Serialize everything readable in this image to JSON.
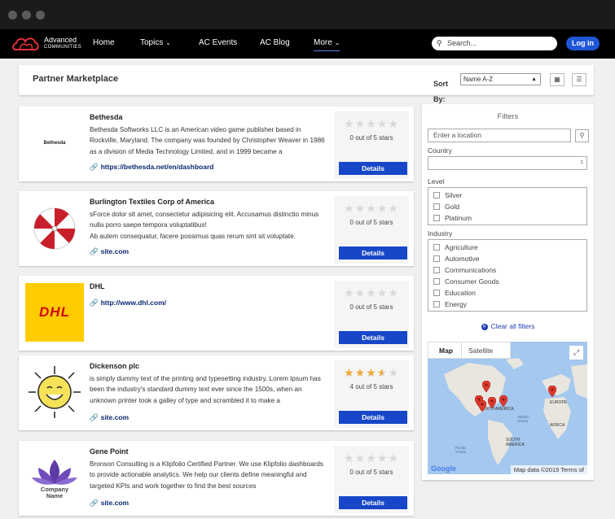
{
  "nav": {
    "brand_line1": "Advanced",
    "brand_line2": "COMMUNITIES",
    "items": [
      {
        "label": "Home"
      },
      {
        "label": "Topics",
        "has_caret": true
      },
      {
        "label": "AC Events"
      },
      {
        "label": "AC Blog"
      },
      {
        "label": "More",
        "has_caret": true
      }
    ],
    "search_placeholder": "Search...",
    "login_label": "Log in",
    "accent_color": "#1f56d8"
  },
  "header": {
    "title": "Partner Marketplace",
    "sort_label": "Sort By:",
    "sort_value": "Name A-Z",
    "grid_icon": "grid-view-icon",
    "list_icon": "list-view-icon"
  },
  "partners": [
    {
      "name": "Bethesda",
      "logo_text": "Bethesda",
      "description": "Bethesda Softworks LLC is an American video game publisher based in Rockville, Maryland. The company was founded by Christopher Weaver in 1986 as a division of Media Technology Limited, and in 1999 became a",
      "link": "https://bethesda.net/en/dashboard",
      "stars": 0,
      "rating_text": "0 out of 5 stars",
      "button": "Details"
    },
    {
      "name": "Burlington Textiles Corp of America",
      "description": "sForce dolor sit amet, consectetur adipisicing elit. Accusamus distinctio minus nulla porro saepe tempora voluptatibus!\nAb autem consequatur, facere possimus quas rerum sint sit voluptate.",
      "link": "site.com",
      "stars": 0,
      "rating_text": "0 out of 5 stars",
      "button": "Details"
    },
    {
      "name": "DHL",
      "logo_text": "DHL",
      "description": "",
      "link": "http://www.dhl.com/",
      "stars": 0,
      "rating_text": "0 out of 5 stars",
      "button": "Details"
    },
    {
      "name": "Dickenson plc",
      "description": "is simply dummy text of the printing and typesetting industry. Lorem Ipsum has been the industry's standard dummy text ever since the 1500s, when an unknown printer took a galley of type and scrambled it to make a",
      "link": "site.com",
      "stars": 3.5,
      "rating_text": "4 out of 5 stars",
      "button": "Details"
    },
    {
      "name": "Gene Point",
      "logo_text": "Company Name",
      "description": "Bronson Consulting is a Klipfolio Certified Partner. We use Klipfolio dashboards to provide actionable analytics. We help our clients define meaningful and targeted KPIs and work together to find the best sources",
      "link": "site.com",
      "stars": 0,
      "rating_text": "0 out of 5 stars",
      "button": "Details"
    }
  ],
  "filters": {
    "title": "Filters",
    "location_placeholder": "Enter a location",
    "country_label": "Country",
    "level_label": "Level",
    "levels": [
      "Silver",
      "Gold",
      "Platinum"
    ],
    "industry_label": "Industry",
    "industries": [
      "Agriculture",
      "Automotive",
      "Communications",
      "Consumer Goods",
      "Education",
      "Energy"
    ],
    "clear_label": "Clear all filters"
  },
  "map": {
    "tab_map": "Map",
    "tab_satellite": "Satellite",
    "active_tab": "Map",
    "footer": "Map data ©2019   Terms of",
    "provider": "Google",
    "labels": [
      "EUROPE",
      "AFRICA",
      "SOUTH AMERICA",
      "NORTH AMERICA",
      "Atlantic Ocean",
      "Pacific Ocean"
    ]
  }
}
